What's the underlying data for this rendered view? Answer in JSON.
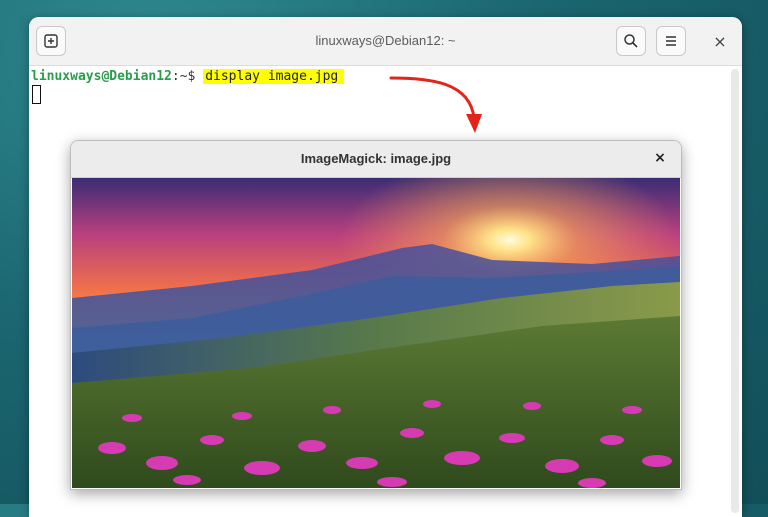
{
  "terminal": {
    "title": "linuxways@Debian12: ~",
    "prompt_user": "linuxways@Debian12",
    "prompt_sep": ":",
    "prompt_path": "~$",
    "command": "display image.jpg",
    "icons": {
      "new_tab": "new-tab-icon",
      "search": "search-icon",
      "menu": "hamburger-menu-icon",
      "close": "close-icon"
    },
    "close_glyph": "×"
  },
  "imagemagick": {
    "title": "ImageMagick: image.jpg",
    "close_glyph": "×",
    "image_description_icon": "landscape-photo"
  },
  "colors": {
    "highlight": "#ffff00",
    "prompt_user": "#2a9d4b",
    "arrow": "#e3241b"
  }
}
